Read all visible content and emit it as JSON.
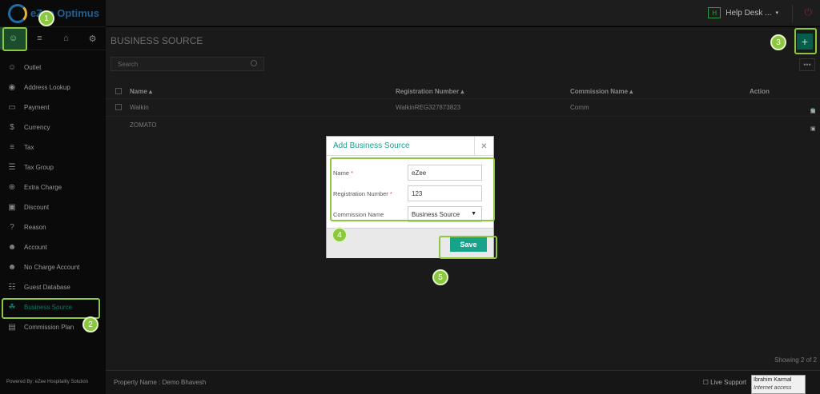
{
  "app": {
    "logo_text": "eZee Optimus",
    "powered_by": "Powered By: eZee Hospitality Solution"
  },
  "sidebar": {
    "icon_tabs": [
      {
        "icon": "user-icon",
        "glyph": "☺"
      },
      {
        "icon": "menu-icon",
        "glyph": "≡"
      },
      {
        "icon": "cart-icon",
        "glyph": "⌂"
      },
      {
        "icon": "gear-icon",
        "glyph": "⚙"
      }
    ],
    "items": [
      {
        "label": "Outlet",
        "icon": "user-icon",
        "glyph": "☺"
      },
      {
        "label": "Address Lookup",
        "icon": "map-pin-icon",
        "glyph": "◉"
      },
      {
        "label": "Payment",
        "icon": "card-icon",
        "glyph": "▭"
      },
      {
        "label": "Currency",
        "icon": "dollar-icon",
        "glyph": "$"
      },
      {
        "label": "Tax",
        "icon": "list-icon",
        "glyph": "≡"
      },
      {
        "label": "Tax Group",
        "icon": "list-group-icon",
        "glyph": "☰"
      },
      {
        "label": "Extra Charge",
        "icon": "plus-circle-icon",
        "glyph": "⊕"
      },
      {
        "label": "Discount",
        "icon": "gift-icon",
        "glyph": "▣"
      },
      {
        "label": "Reason",
        "icon": "question-icon",
        "glyph": "?"
      },
      {
        "label": "Account",
        "icon": "person-icon",
        "glyph": "☻"
      },
      {
        "label": "No Charge Account",
        "icon": "person-icon",
        "glyph": "☻"
      },
      {
        "label": "Guest Database",
        "icon": "database-icon",
        "glyph": "☷"
      },
      {
        "label": "Business Source",
        "icon": "handshake-icon",
        "glyph": "☘"
      },
      {
        "label": "Commission Plan",
        "icon": "money-icon",
        "glyph": "▤"
      }
    ]
  },
  "header": {
    "helpdesk_badge": "H",
    "helpdesk_label": "Help Desk ...",
    "caret": "▾",
    "power_glyph": "⏻"
  },
  "main": {
    "title": "BUSINESS SOURCE",
    "add_glyph": "+",
    "more_glyph": "•••",
    "search_placeholder": "Search",
    "columns": {
      "name": "Name ▴",
      "registration": "Registration Number ▴",
      "commission": "Commission Name ▴",
      "action": "Action"
    },
    "rows": [
      {
        "name": "Walkin",
        "registration": "WalkinREG327873823",
        "commission": "Comm"
      },
      {
        "name": "ZOMATO",
        "registration": "",
        "commission": ""
      }
    ],
    "showing": "Showing 2 of 2"
  },
  "footer": {
    "property": "Property Name : Demo Bhavesh",
    "live_support": "☐ Live Support",
    "tooltip_name": "Ibrahim Karmal",
    "tooltip_sub": "Internet access"
  },
  "modal": {
    "title": "Add Business Source",
    "close_glyph": "✕",
    "name_label": "Name",
    "name_value": "eZee",
    "reg_label": "Registration Number",
    "reg_value": "123",
    "commission_label": "Commission Name",
    "commission_value": "Business Source",
    "req_mark": "*",
    "save_label": "Save"
  },
  "steps": [
    "1",
    "2",
    "3",
    "4",
    "5"
  ],
  "colors": {
    "accent": "#8bc83f",
    "teal": "#16a38a"
  }
}
